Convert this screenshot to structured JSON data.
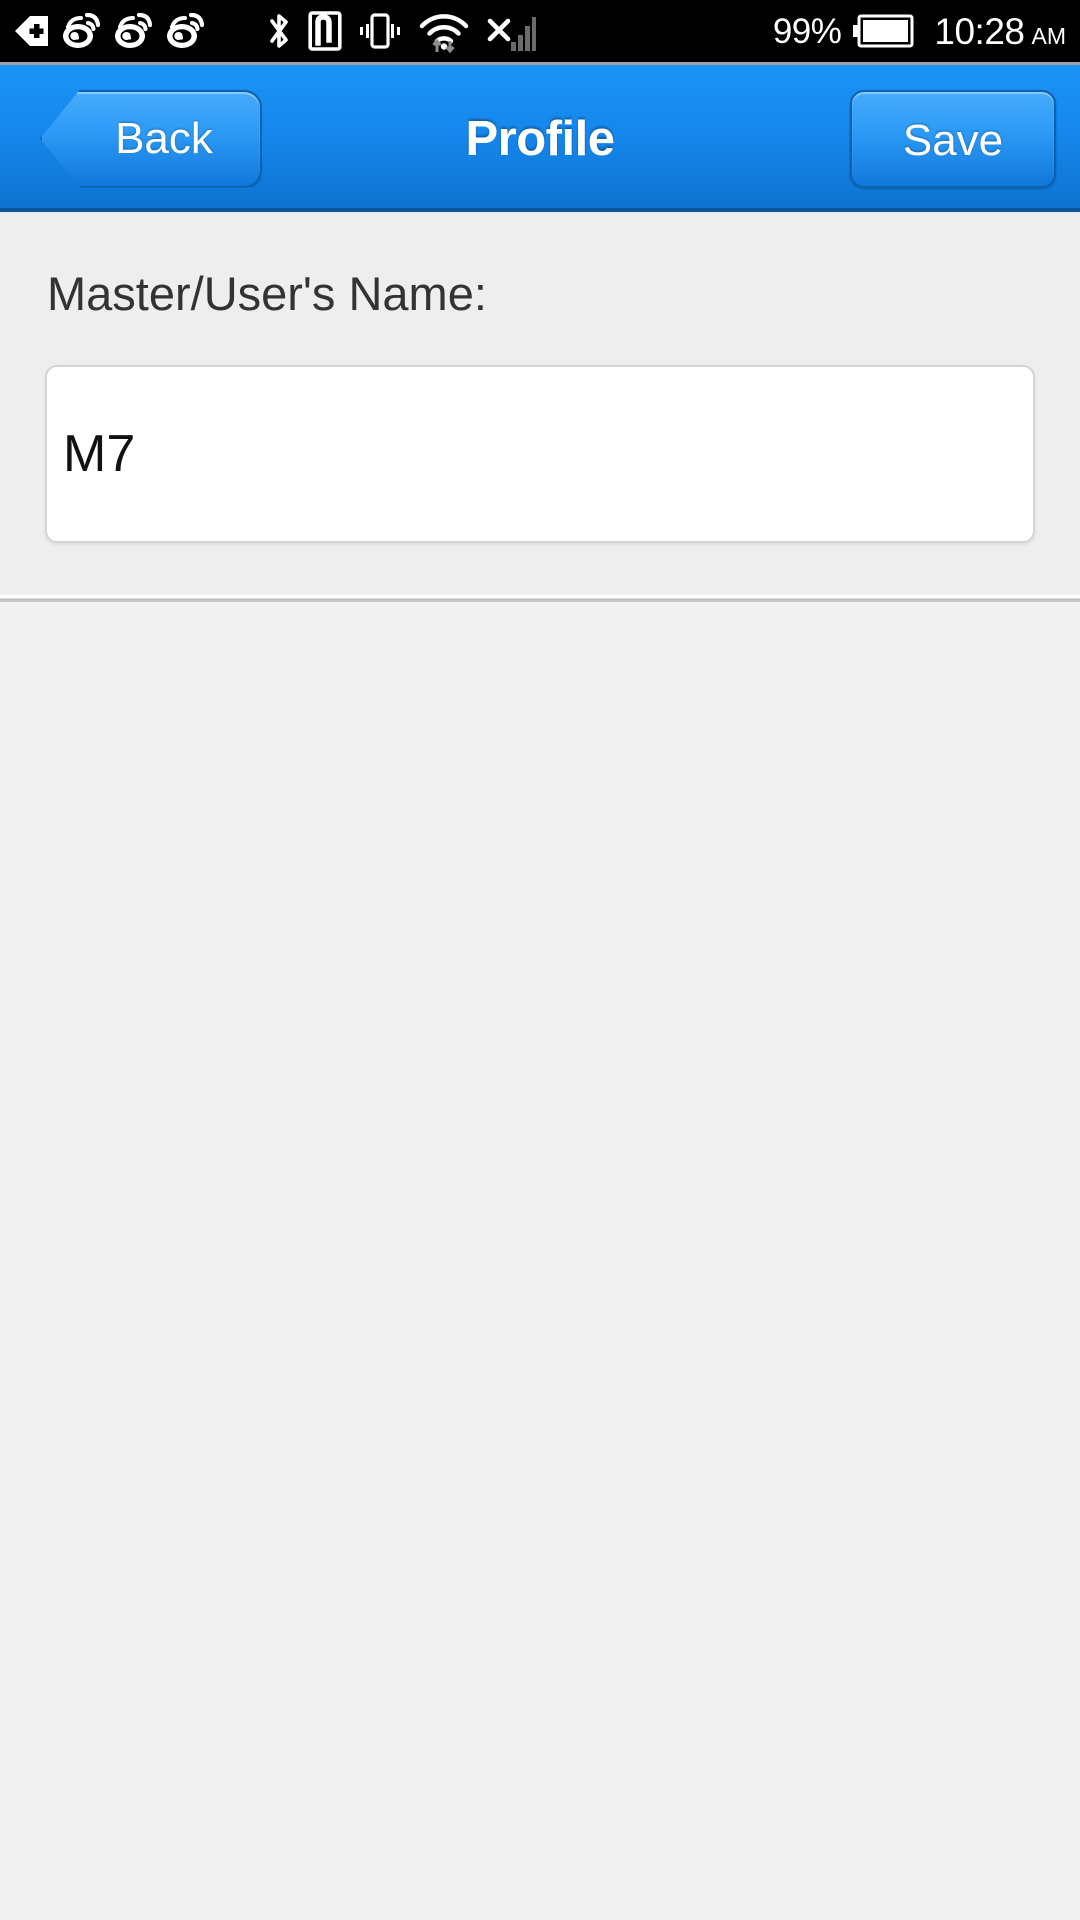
{
  "status_bar": {
    "icons_left": [
      {
        "name": "app-update-icon",
        "label": "update"
      },
      {
        "name": "weibo-icon-1",
        "label": "weibo"
      },
      {
        "name": "weibo-icon-2",
        "label": "weibo"
      },
      {
        "name": "weibo-icon-3",
        "label": "weibo"
      }
    ],
    "icons_mid": [
      {
        "name": "bluetooth-icon",
        "label": "bluetooth"
      },
      {
        "name": "nfc-icon",
        "label": "nfc"
      },
      {
        "name": "vibrate-icon",
        "label": "vibrate"
      },
      {
        "name": "wifi-icon",
        "label": "wifi"
      },
      {
        "name": "no-sim-signal-icon",
        "label": "signal"
      }
    ],
    "battery_percent": "99%",
    "time": "10:28",
    "time_period": "AM",
    "background_color": "#000000",
    "foreground_color": "#ffffff"
  },
  "nav_bar": {
    "back_label": "Back",
    "title": "Profile",
    "save_label": "Save",
    "accent_color": "#1688ee",
    "border_color": "#0c62ae",
    "text_color": "#ffffff"
  },
  "form": {
    "name_label": "Master/User's Name:",
    "name_value": "M7",
    "name_placeholder": "",
    "section_background": "#eeeeee",
    "field_background": "#ffffff",
    "label_color": "#333333"
  },
  "page": {
    "background_color": "#f1f1f1"
  }
}
